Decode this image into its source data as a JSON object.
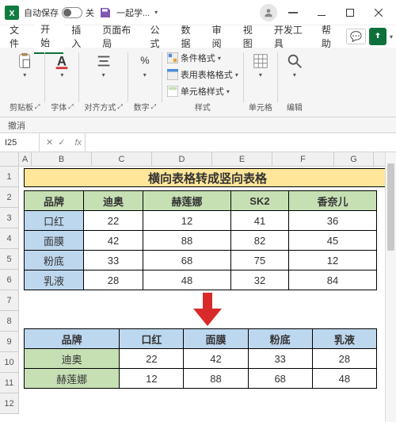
{
  "titlebar": {
    "autosave_label": "自动保存",
    "autosave_state": "关",
    "doc_name": "一起学..."
  },
  "tabs": {
    "file": "文件",
    "home": "开始",
    "insert": "插入",
    "layout": "页面布局",
    "formulas": "公式",
    "data": "数据",
    "review": "审阅",
    "view": "视图",
    "developer": "开发工具",
    "help": "帮助"
  },
  "ribbon": {
    "clipboard": "剪贴板",
    "font": "字体",
    "align": "对齐方式",
    "number": "数字",
    "cond_format": "条件格式",
    "table_format": "表用表格格式",
    "cell_style": "单元格样式",
    "styles": "样式",
    "cells": "单元格",
    "editing": "编辑",
    "undo": "撤消"
  },
  "fx": {
    "cell": "I25",
    "label": "fx"
  },
  "cols": [
    "A",
    "B",
    "C",
    "D",
    "E",
    "F",
    "G"
  ],
  "rows": [
    "1",
    "2",
    "3",
    "4",
    "5",
    "6",
    "7",
    "8",
    "9",
    "10",
    "11",
    "12"
  ],
  "title_cell": "横向表格转成竖向表格",
  "table1": {
    "headers": [
      "品牌",
      "迪奥",
      "赫莲娜",
      "SK2",
      "香奈儿"
    ],
    "rows": [
      [
        "口红",
        "22",
        "12",
        "41",
        "36"
      ],
      [
        "面膜",
        "42",
        "88",
        "82",
        "45"
      ],
      [
        "粉底",
        "33",
        "68",
        "75",
        "12"
      ],
      [
        "乳液",
        "28",
        "48",
        "32",
        "84"
      ]
    ]
  },
  "table2": {
    "headers": [
      "品牌",
      "口红",
      "面膜",
      "粉底",
      "乳液"
    ],
    "rows": [
      [
        "迪奥",
        "22",
        "42",
        "33",
        "28"
      ],
      [
        "赫莲娜",
        "12",
        "88",
        "68",
        "48"
      ]
    ]
  }
}
